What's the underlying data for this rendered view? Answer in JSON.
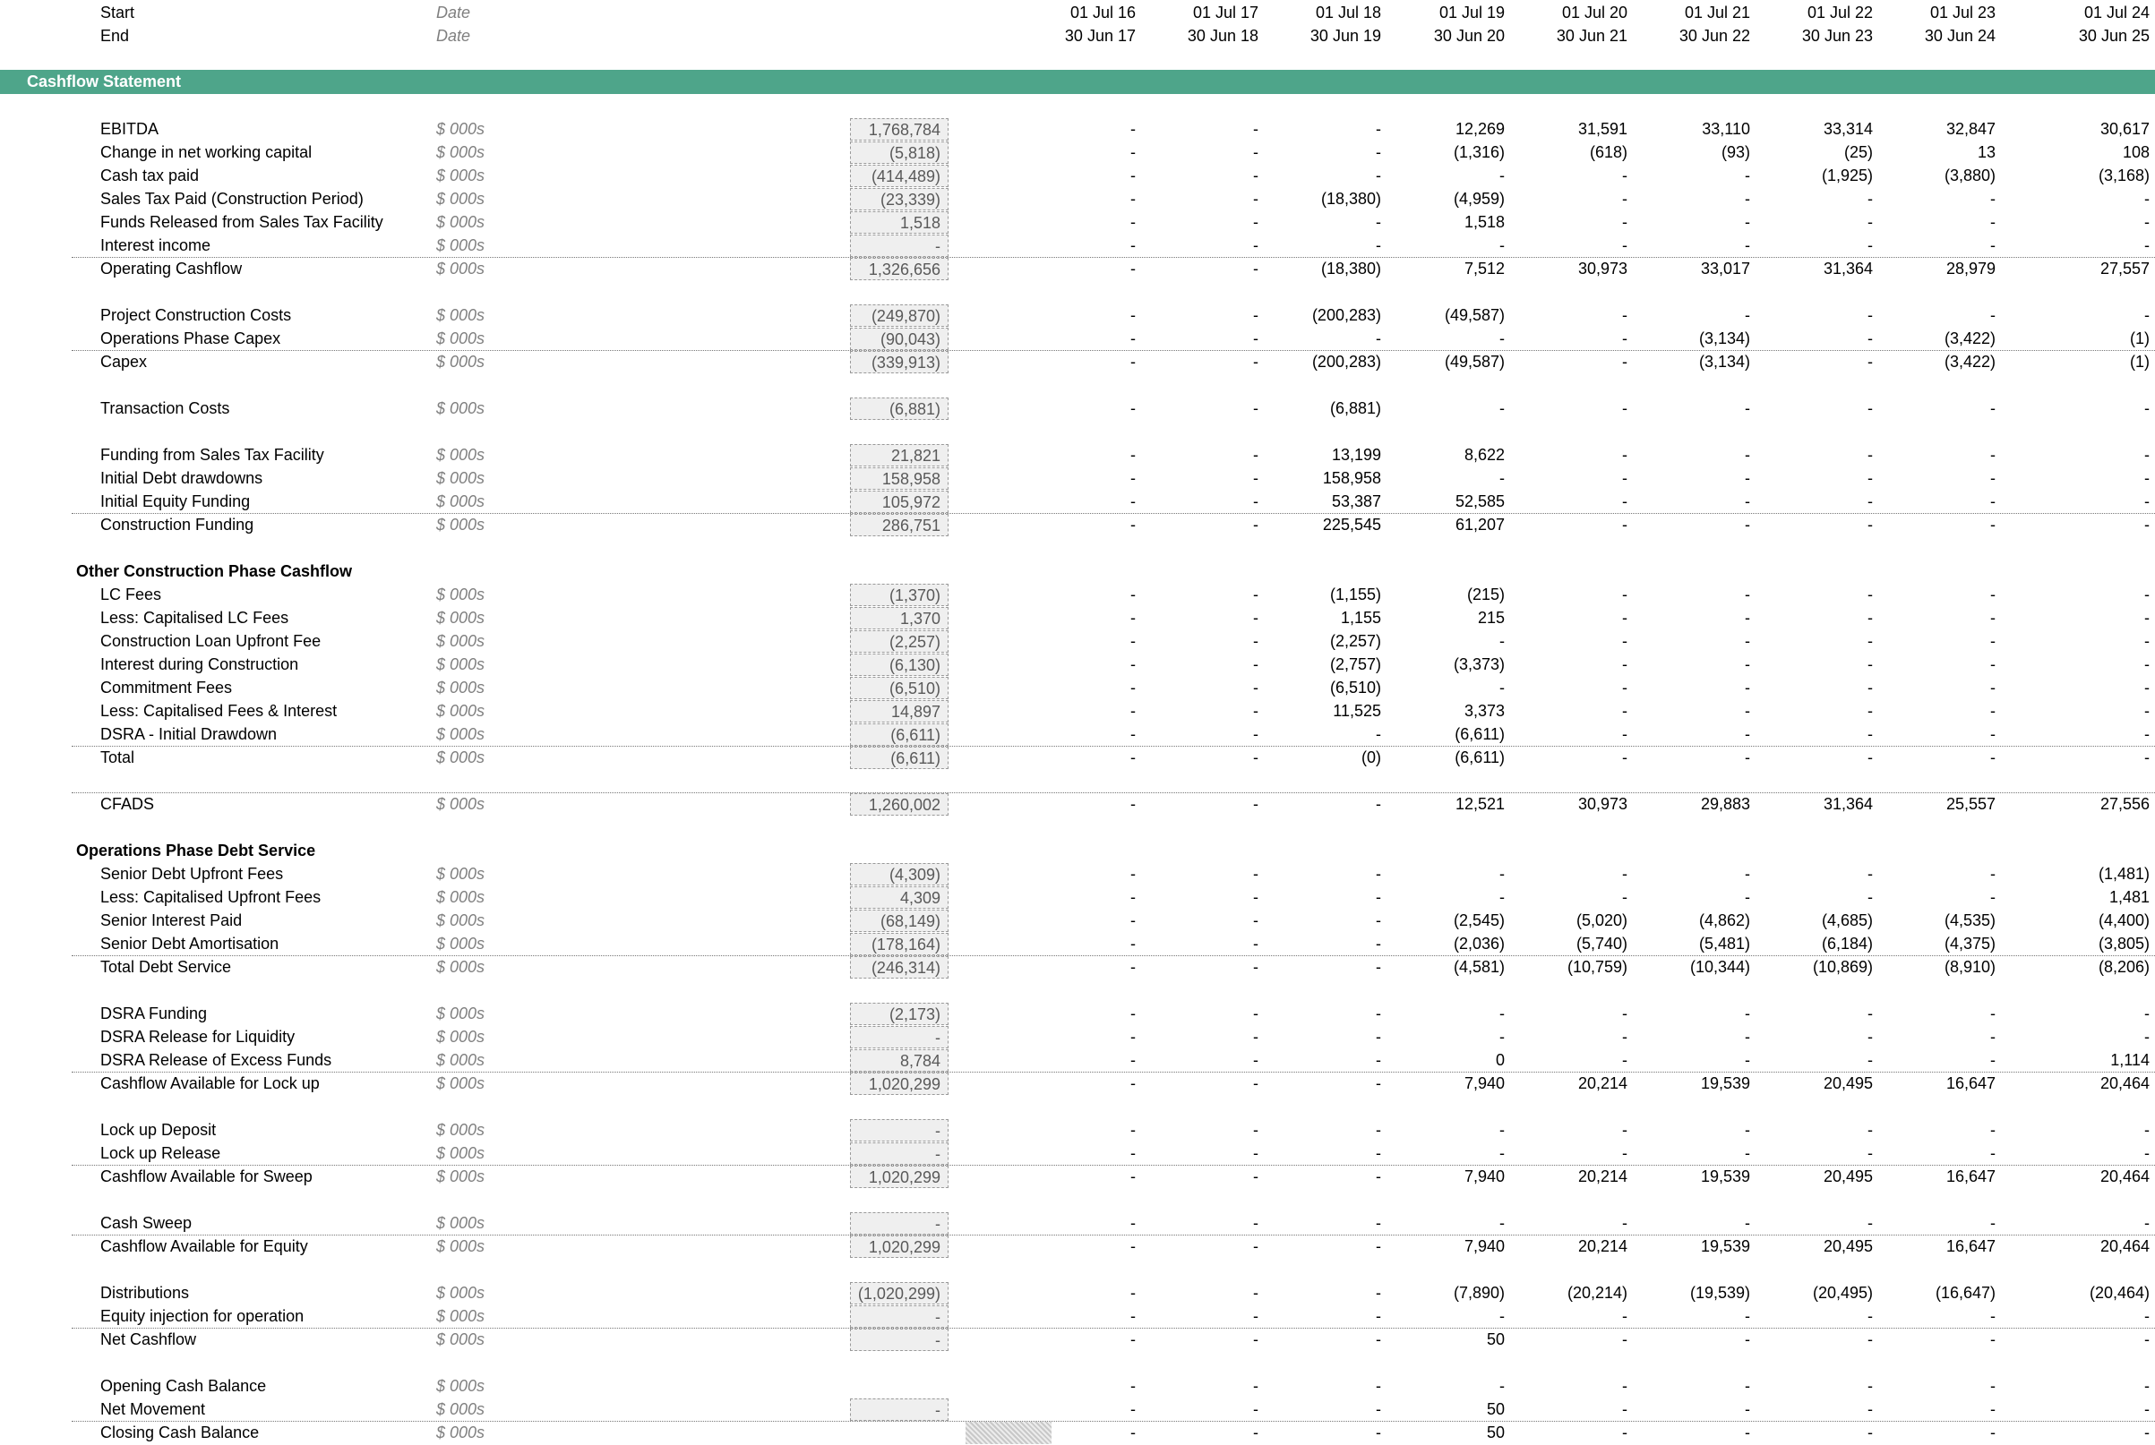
{
  "header": {
    "start_label": "Start",
    "end_label": "End",
    "date_unit": "Date",
    "start_dates": [
      "01 Jul 16",
      "01 Jul 17",
      "01 Jul 18",
      "01 Jul 19",
      "01 Jul 20",
      "01 Jul 21",
      "01 Jul 22",
      "01 Jul 23",
      "01 Jul 24"
    ],
    "end_dates": [
      "30 Jun 17",
      "30 Jun 18",
      "30 Jun 19",
      "30 Jun 20",
      "30 Jun 21",
      "30 Jun 22",
      "30 Jun 23",
      "30 Jun 24",
      "30 Jun 25"
    ]
  },
  "section_title": "Cashflow Statement",
  "rows": [
    {
      "type": "line",
      "label": "EBITDA",
      "unit": "$ 000s",
      "sum": "1,768,784",
      "values": [
        "-",
        "-",
        "-",
        "12,269",
        "31,591",
        "33,110",
        "33,314",
        "32,847",
        "30,617"
      ]
    },
    {
      "type": "line",
      "label": "Change in net working capital",
      "unit": "$ 000s",
      "sum": "(5,818)",
      "values": [
        "-",
        "-",
        "-",
        "(1,316)",
        "(618)",
        "(93)",
        "(25)",
        "13",
        "108"
      ]
    },
    {
      "type": "line",
      "label": "Cash tax paid",
      "unit": "$ 000s",
      "sum": "(414,489)",
      "values": [
        "-",
        "-",
        "-",
        "-",
        "-",
        "-",
        "(1,925)",
        "(3,880)",
        "(3,168)"
      ]
    },
    {
      "type": "line",
      "label": "Sales Tax Paid (Construction Period)",
      "unit": "$ 000s",
      "sum": "(23,339)",
      "values": [
        "-",
        "-",
        "(18,380)",
        "(4,959)",
        "-",
        "-",
        "-",
        "-",
        "-"
      ]
    },
    {
      "type": "line",
      "label": "Funds Released from Sales Tax Facility",
      "unit": "$ 000s",
      "sum": "1,518",
      "values": [
        "-",
        "-",
        "-",
        "1,518",
        "-",
        "-",
        "-",
        "-",
        "-"
      ]
    },
    {
      "type": "line",
      "label": "Interest income",
      "unit": "$ 000s",
      "sum": "-",
      "values": [
        "-",
        "-",
        "-",
        "-",
        "-",
        "-",
        "-",
        "-",
        "-"
      ]
    },
    {
      "type": "total",
      "label": "Operating Cashflow",
      "unit": "$ 000s",
      "sum": "1,326,656",
      "values": [
        "-",
        "-",
        "(18,380)",
        "7,512",
        "30,973",
        "33,017",
        "31,364",
        "28,979",
        "27,557"
      ]
    },
    {
      "type": "blank"
    },
    {
      "type": "line",
      "label": "Project Construction Costs",
      "unit": "$ 000s",
      "sum": "(249,870)",
      "values": [
        "-",
        "-",
        "(200,283)",
        "(49,587)",
        "-",
        "-",
        "-",
        "-",
        "-"
      ]
    },
    {
      "type": "line",
      "label": "Operations Phase Capex",
      "unit": "$ 000s",
      "sum": "(90,043)",
      "values": [
        "-",
        "-",
        "-",
        "-",
        "-",
        "(3,134)",
        "-",
        "(3,422)",
        "(1)"
      ]
    },
    {
      "type": "total",
      "label": "Capex",
      "unit": "$ 000s",
      "sum": "(339,913)",
      "values": [
        "-",
        "-",
        "(200,283)",
        "(49,587)",
        "-",
        "(3,134)",
        "-",
        "(3,422)",
        "(1)"
      ]
    },
    {
      "type": "blank"
    },
    {
      "type": "line",
      "label": "Transaction Costs",
      "unit": "$ 000s",
      "sum": "(6,881)",
      "values": [
        "-",
        "-",
        "(6,881)",
        "-",
        "-",
        "-",
        "-",
        "-",
        "-"
      ]
    },
    {
      "type": "blank"
    },
    {
      "type": "line",
      "label": "Funding from Sales Tax Facility",
      "unit": "$ 000s",
      "sum": "21,821",
      "values": [
        "-",
        "-",
        "13,199",
        "8,622",
        "-",
        "-",
        "-",
        "-",
        "-"
      ]
    },
    {
      "type": "line",
      "label": "Initial Debt drawdowns",
      "unit": "$ 000s",
      "sum": "158,958",
      "values": [
        "-",
        "-",
        "158,958",
        "-",
        "-",
        "-",
        "-",
        "-",
        "-"
      ]
    },
    {
      "type": "line",
      "label": "Initial Equity Funding",
      "unit": "$ 000s",
      "sum": "105,972",
      "values": [
        "-",
        "-",
        "53,387",
        "52,585",
        "-",
        "-",
        "-",
        "-",
        "-"
      ]
    },
    {
      "type": "total",
      "label": "Construction Funding",
      "unit": "$ 000s",
      "sum": "286,751",
      "values": [
        "-",
        "-",
        "225,545",
        "61,207",
        "-",
        "-",
        "-",
        "-",
        "-"
      ]
    },
    {
      "type": "blank"
    },
    {
      "type": "section",
      "label": "Other Construction Phase Cashflow"
    },
    {
      "type": "line",
      "label": "LC Fees",
      "unit": "$ 000s",
      "sum": "(1,370)",
      "values": [
        "-",
        "-",
        "(1,155)",
        "(215)",
        "-",
        "-",
        "-",
        "-",
        "-"
      ]
    },
    {
      "type": "line",
      "label": "Less: Capitalised LC Fees",
      "unit": "$ 000s",
      "sum": "1,370",
      "values": [
        "-",
        "-",
        "1,155",
        "215",
        "-",
        "-",
        "-",
        "-",
        "-"
      ]
    },
    {
      "type": "line",
      "label": "Construction Loan Upfront Fee",
      "unit": "$ 000s",
      "sum": "(2,257)",
      "values": [
        "-",
        "-",
        "(2,257)",
        "-",
        "-",
        "-",
        "-",
        "-",
        "-"
      ]
    },
    {
      "type": "line",
      "label": "Interest during Construction",
      "unit": "$ 000s",
      "sum": "(6,130)",
      "values": [
        "-",
        "-",
        "(2,757)",
        "(3,373)",
        "-",
        "-",
        "-",
        "-",
        "-"
      ]
    },
    {
      "type": "line",
      "label": "Commitment Fees",
      "unit": "$ 000s",
      "sum": "(6,510)",
      "values": [
        "-",
        "-",
        "(6,510)",
        "-",
        "-",
        "-",
        "-",
        "-",
        "-"
      ]
    },
    {
      "type": "line",
      "label": "Less: Capitalised Fees & Interest",
      "unit": "$ 000s",
      "sum": "14,897",
      "values": [
        "-",
        "-",
        "11,525",
        "3,373",
        "-",
        "-",
        "-",
        "-",
        "-"
      ]
    },
    {
      "type": "line",
      "label": "DSRA - Initial Drawdown",
      "unit": "$ 000s",
      "sum": "(6,611)",
      "values": [
        "-",
        "-",
        "-",
        "(6,611)",
        "-",
        "-",
        "-",
        "-",
        "-"
      ]
    },
    {
      "type": "total",
      "label": "Total",
      "unit": "$ 000s",
      "sum": "(6,611)",
      "values": [
        "-",
        "-",
        "(0)",
        "(6,611)",
        "-",
        "-",
        "-",
        "-",
        "-"
      ]
    },
    {
      "type": "blank"
    },
    {
      "type": "total",
      "label": "CFADS",
      "unit": "$ 000s",
      "sum": "1,260,002",
      "values": [
        "-",
        "-",
        "-",
        "12,521",
        "30,973",
        "29,883",
        "31,364",
        "25,557",
        "27,556"
      ]
    },
    {
      "type": "blank"
    },
    {
      "type": "section",
      "label": "Operations Phase Debt Service"
    },
    {
      "type": "line",
      "label": "Senior Debt Upfront Fees",
      "unit": "$ 000s",
      "sum": "(4,309)",
      "values": [
        "-",
        "-",
        "-",
        "-",
        "-",
        "-",
        "-",
        "-",
        "(1,481)"
      ]
    },
    {
      "type": "line",
      "label": "Less: Capitalised Upfront Fees",
      "unit": "$ 000s",
      "sum": "4,309",
      "values": [
        "-",
        "-",
        "-",
        "-",
        "-",
        "-",
        "-",
        "-",
        "1,481"
      ]
    },
    {
      "type": "line",
      "label": "Senior Interest Paid",
      "unit": "$ 000s",
      "sum": "(68,149)",
      "values": [
        "-",
        "-",
        "-",
        "(2,545)",
        "(5,020)",
        "(4,862)",
        "(4,685)",
        "(4,535)",
        "(4,400)"
      ]
    },
    {
      "type": "line",
      "label": "Senior Debt Amortisation",
      "unit": "$ 000s",
      "sum": "(178,164)",
      "values": [
        "-",
        "-",
        "-",
        "(2,036)",
        "(5,740)",
        "(5,481)",
        "(6,184)",
        "(4,375)",
        "(3,805)"
      ]
    },
    {
      "type": "total",
      "label": "Total Debt Service",
      "unit": "$ 000s",
      "sum": "(246,314)",
      "values": [
        "-",
        "-",
        "-",
        "(4,581)",
        "(10,759)",
        "(10,344)",
        "(10,869)",
        "(8,910)",
        "(8,206)"
      ]
    },
    {
      "type": "blank"
    },
    {
      "type": "line",
      "label": "DSRA Funding",
      "unit": "$ 000s",
      "sum": "(2,173)",
      "values": [
        "-",
        "-",
        "-",
        "-",
        "-",
        "-",
        "-",
        "-",
        "-"
      ]
    },
    {
      "type": "line",
      "label": "DSRA Release for Liquidity",
      "unit": "$ 000s",
      "sum": "-",
      "values": [
        "-",
        "-",
        "-",
        "-",
        "-",
        "-",
        "-",
        "-",
        "-"
      ]
    },
    {
      "type": "line",
      "label": "DSRA Release of Excess Funds",
      "unit": "$ 000s",
      "sum": "8,784",
      "values": [
        "-",
        "-",
        "-",
        "0",
        "-",
        "-",
        "-",
        "-",
        "1,114"
      ]
    },
    {
      "type": "total",
      "label": "Cashflow Available for Lock up",
      "unit": "$ 000s",
      "sum": "1,020,299",
      "values": [
        "-",
        "-",
        "-",
        "7,940",
        "20,214",
        "19,539",
        "20,495",
        "16,647",
        "20,464"
      ]
    },
    {
      "type": "blank"
    },
    {
      "type": "line",
      "label": "Lock up Deposit",
      "unit": "$ 000s",
      "sum": "-",
      "values": [
        "-",
        "-",
        "-",
        "-",
        "-",
        "-",
        "-",
        "-",
        "-"
      ]
    },
    {
      "type": "line",
      "label": "Lock up Release",
      "unit": "$ 000s",
      "sum": "-",
      "values": [
        "-",
        "-",
        "-",
        "-",
        "-",
        "-",
        "-",
        "-",
        "-"
      ]
    },
    {
      "type": "total",
      "label": "Cashflow Available for Sweep",
      "unit": "$ 000s",
      "sum": "1,020,299",
      "values": [
        "-",
        "-",
        "-",
        "7,940",
        "20,214",
        "19,539",
        "20,495",
        "16,647",
        "20,464"
      ]
    },
    {
      "type": "blank"
    },
    {
      "type": "line",
      "label": "Cash Sweep",
      "unit": "$ 000s",
      "sum": "-",
      "values": [
        "-",
        "-",
        "-",
        "-",
        "-",
        "-",
        "-",
        "-",
        "-"
      ]
    },
    {
      "type": "total",
      "label": "Cashflow Available for Equity",
      "unit": "$ 000s",
      "sum": "1,020,299",
      "values": [
        "-",
        "-",
        "-",
        "7,940",
        "20,214",
        "19,539",
        "20,495",
        "16,647",
        "20,464"
      ]
    },
    {
      "type": "blank"
    },
    {
      "type": "line",
      "label": "Distributions",
      "unit": "$ 000s",
      "sum": "(1,020,299)",
      "values": [
        "-",
        "-",
        "-",
        "(7,890)",
        "(20,214)",
        "(19,539)",
        "(20,495)",
        "(16,647)",
        "(20,464)"
      ]
    },
    {
      "type": "line",
      "label": "Equity injection for operation",
      "unit": "$ 000s",
      "sum": "-",
      "values": [
        "-",
        "-",
        "-",
        "-",
        "-",
        "-",
        "-",
        "-",
        "-"
      ]
    },
    {
      "type": "total",
      "label": "Net Cashflow",
      "unit": "$ 000s",
      "sum": "-",
      "values": [
        "-",
        "-",
        "-",
        "50",
        "-",
        "-",
        "-",
        "-",
        "-"
      ]
    },
    {
      "type": "blank"
    },
    {
      "type": "line",
      "label": "Opening Cash Balance",
      "unit": "$ 000s",
      "values": [
        "-",
        "-",
        "-",
        "-",
        "-",
        "-",
        "-",
        "-",
        "-"
      ]
    },
    {
      "type": "line",
      "label": "Net Movement",
      "unit": "$ 000s",
      "sum": "-",
      "values": [
        "-",
        "-",
        "-",
        "50",
        "-",
        "-",
        "-",
        "-",
        "-"
      ]
    },
    {
      "type": "total",
      "label": "Closing Cash Balance",
      "unit": "$ 000s",
      "values": [
        "-",
        "-",
        "-",
        "50",
        "-",
        "-",
        "-",
        "-",
        "-"
      ]
    }
  ]
}
